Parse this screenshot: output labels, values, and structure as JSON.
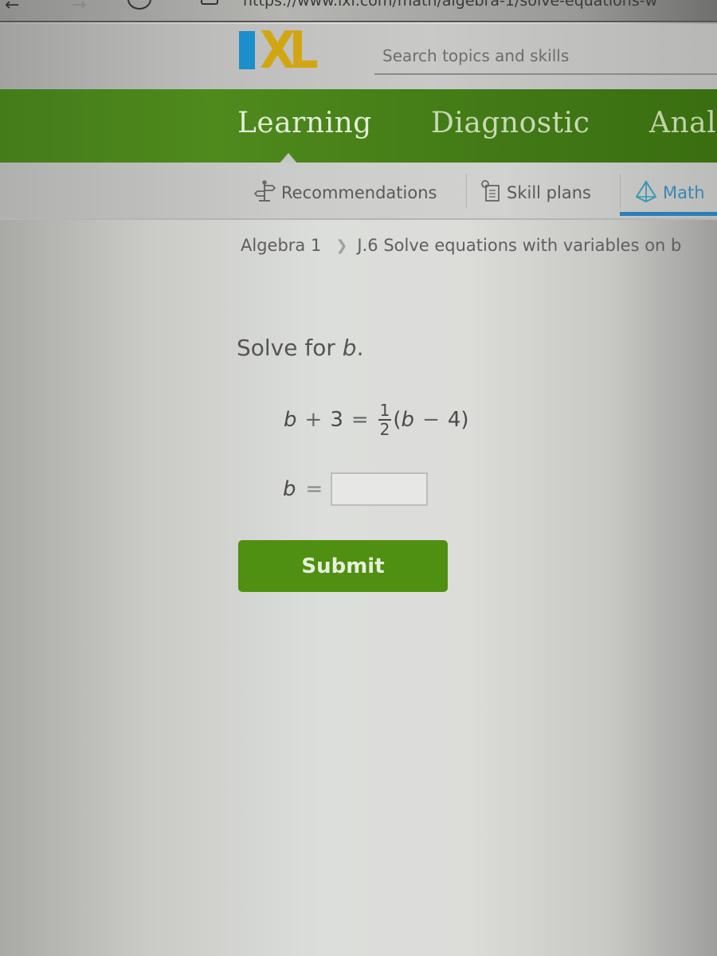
{
  "browser": {
    "url": "https://www.ixl.com/math/algebra-1/solve-equations-w"
  },
  "header": {
    "logo_i": "I",
    "logo_xl": "XL",
    "search_placeholder": "Search topics and skills"
  },
  "main_nav": {
    "items": [
      {
        "label": "Learning",
        "active": true
      },
      {
        "label": "Diagnostic",
        "active": false
      },
      {
        "label": "Anal",
        "active": false
      }
    ]
  },
  "sub_nav": {
    "items": [
      {
        "label": "Recommendations",
        "icon": "signpost-icon",
        "active": false
      },
      {
        "label": "Skill plans",
        "icon": "clipboard-icon",
        "active": false
      },
      {
        "label": "Math",
        "icon": "pyramid-icon",
        "active": true
      }
    ],
    "accent_color": "#2a7fb8"
  },
  "breadcrumb": {
    "items": [
      "Algebra 1",
      "J.6 Solve equations with variables on b"
    ],
    "separator": ">"
  },
  "question": {
    "prompt_prefix": "Solve for ",
    "prompt_variable": "b",
    "prompt_suffix": ".",
    "equation": {
      "lhs_var": "b",
      "lhs_op": "+",
      "lhs_const": "3",
      "equals": "=",
      "frac_num": "1",
      "frac_den": "2",
      "rhs_open": "(",
      "rhs_var": "b",
      "rhs_op": "−",
      "rhs_const": "4",
      "rhs_close": ")"
    },
    "answer_var": "b",
    "answer_equals": "=",
    "answer_value": ""
  },
  "actions": {
    "submit_label": "Submit",
    "submit_color": "#4f8f11"
  }
}
